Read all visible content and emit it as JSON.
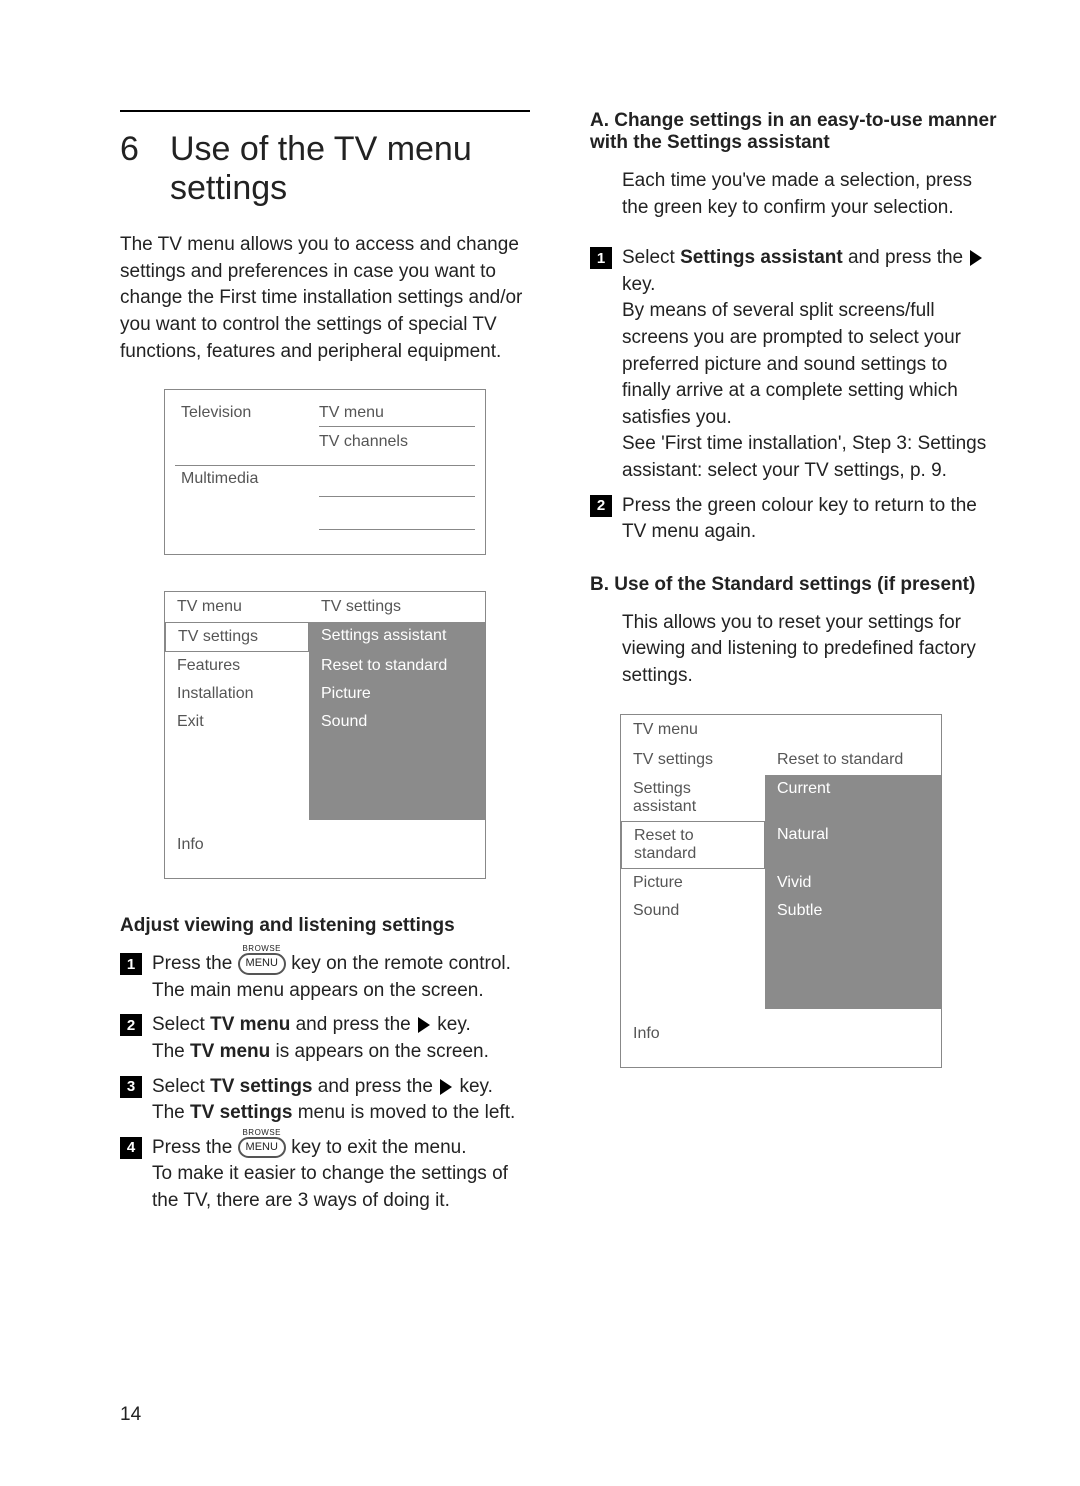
{
  "section": {
    "number": "6",
    "title": "Use of the TV menu settings"
  },
  "left": {
    "intro": "The TV menu allows you to access and change settings and preferences in case you want to change the First time installation settings and/or you want to control the settings of special TV functions, features and peripheral equipment.",
    "diagram1": {
      "rows": [
        {
          "left": "Television",
          "right": [
            "TV menu",
            "TV channels"
          ]
        },
        {
          "left": "Multimedia",
          "right": [
            "",
            ""
          ]
        }
      ]
    },
    "diagram2": {
      "header": {
        "left": "TV menu",
        "right": "TV settings"
      },
      "rows": [
        {
          "left": "TV settings",
          "right": "Settings assistant",
          "left_boxed": true
        },
        {
          "left": "Features",
          "right": "Reset to standard"
        },
        {
          "left": "Installation",
          "right": "Picture"
        },
        {
          "left": "Exit",
          "right": "Sound"
        }
      ],
      "info": "Info"
    },
    "adjust_heading": "Adjust viewing and listening settings",
    "steps": [
      {
        "n": "1",
        "pre": "Press the ",
        "key": {
          "browse": "BROWSE",
          "label": "MENU"
        },
        "post": " key on the remote control.",
        "tail": "The main menu appears on the screen."
      },
      {
        "n": "2",
        "text_a": "Select ",
        "bold_a": "TV menu",
        "text_b": " and press the ",
        "icon": true,
        "text_c": " key.",
        "tail_a": "The ",
        "tail_bold": "TV menu",
        "tail_b": " is appears on the screen."
      },
      {
        "n": "3",
        "text_a": "Select ",
        "bold_a": "TV settings",
        "text_b": " and press the ",
        "icon": true,
        "text_c": " key.",
        "tail_a": "The ",
        "tail_bold": "TV settings",
        "tail_b": " menu is moved to the left."
      },
      {
        "n": "4",
        "pre": "Press the ",
        "key": {
          "browse": "BROWSE",
          "label": "MENU"
        },
        "post": " key to exit the menu.",
        "tail": "To make it easier to change the settings of the TV, there are 3 ways of doing it."
      }
    ]
  },
  "right": {
    "A_heading": "A. Change settings in an easy-to-use manner with the Settings assistant",
    "A_para": "Each time you've made a selection, press the green key to confirm your selection.",
    "A_step1": {
      "n": "1",
      "pre": "Select ",
      "bold": "Settings assistant",
      "mid": " and press the ",
      "post": "key.",
      "tail1": "By means of several split screens/full screens you are prompted to select your preferred picture and sound settings to finally arrive at a complete setting which satisfies you.",
      "tail2": "See 'First time installation', Step 3: Settings assistant: select your TV settings, p. 9."
    },
    "A_step2": {
      "n": "2",
      "text": "Press the green colour key to return to the TV menu again."
    },
    "B_heading": "B. Use of the Standard settings (if present)",
    "B_para": "This allows you to reset your settings for viewing and listening to predefined factory settings.",
    "diagram3": {
      "header": {
        "left": "TV menu",
        "right": ""
      },
      "sub": {
        "left": "TV settings",
        "right": "Reset to standard"
      },
      "rows": [
        {
          "left": "Settings assistant",
          "right": "Current"
        },
        {
          "left": "Reset to standard",
          "right": "Natural",
          "left_boxed": true
        },
        {
          "left": "Picture",
          "right": "Vivid"
        },
        {
          "left": "Sound",
          "right": "Subtle"
        }
      ],
      "info": "Info"
    }
  },
  "page_number": "14"
}
